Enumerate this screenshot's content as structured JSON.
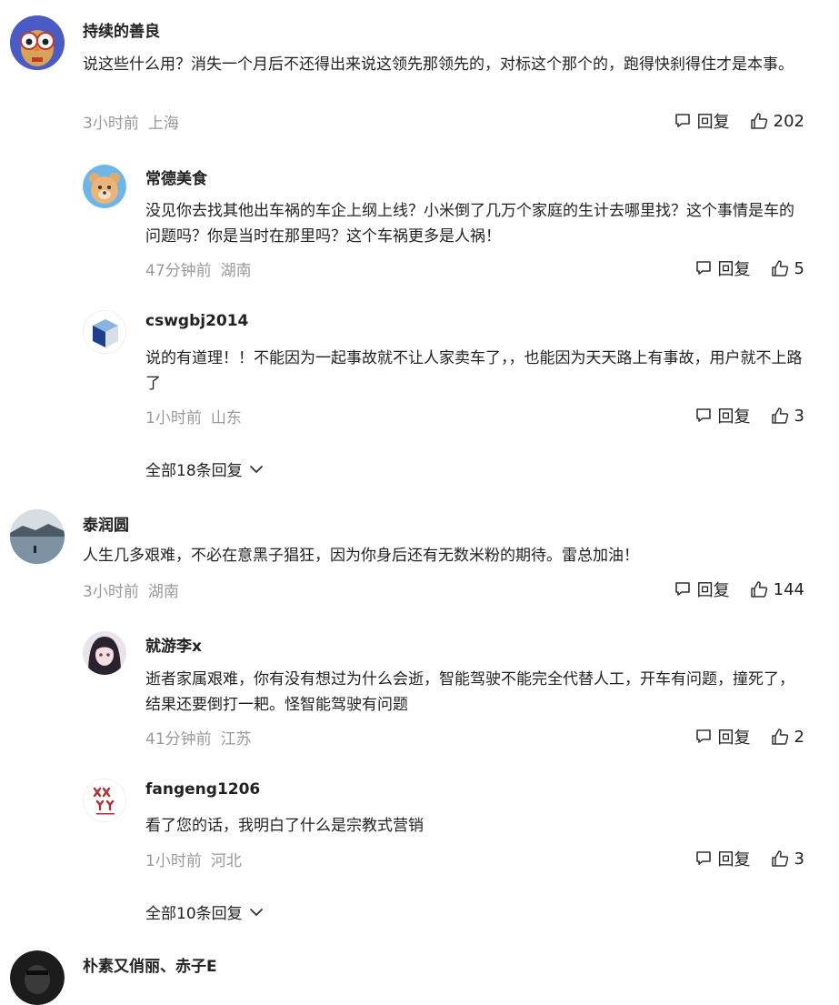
{
  "reply_label": "回复",
  "threads": [
    {
      "user": "持续的善良",
      "text": "说这些什么用？消失一个月后不还得出来说这领先那领先的，对标这个那个的，跑得快刹得住才是本事。",
      "time": "3小时前",
      "location": "上海",
      "likes": "202",
      "replies": [
        {
          "user": "常德美食",
          "text": "没见你去找其他出车祸的车企上纲上线？小米倒了几万个家庭的生计去哪里找？这个事情是车的问题吗？你是当时在那里吗？这个车祸更多是人祸！",
          "time": "47分钟前",
          "location": "湖南",
          "likes": "5"
        },
        {
          "user": "cswgbj2014",
          "text": "说的有道理！！不能因为一起事故就不让人家卖车了，，也能因为天天路上有事故，用户就不上路了",
          "time": "1小时前",
          "location": "山东",
          "likes": "3"
        }
      ],
      "expand_label": "全部18条回复"
    },
    {
      "user": "泰润圆",
      "text": "人生几多艰难，不必在意黑子猖狂，因为你身后还有无数米粉的期待。雷总加油！",
      "time": "3小时前",
      "location": "湖南",
      "likes": "144",
      "replies": [
        {
          "user": "就游李x",
          "text": "逝者家属艰难，你有没有想过为什么会逝，智能驾驶不能完全代替人工，开车有问题，撞死了，结果还要倒打一耙。怪智能驾驶有问题",
          "time": "41分钟前",
          "location": "江苏",
          "likes": "2"
        },
        {
          "user": "fangeng1206",
          "text": "看了您的话，我明白了什么是宗教式营销",
          "time": "1小时前",
          "location": "河北",
          "likes": "3"
        }
      ],
      "expand_label": "全部10条回复"
    },
    {
      "user": "朴素又俏丽、赤子E"
    }
  ]
}
